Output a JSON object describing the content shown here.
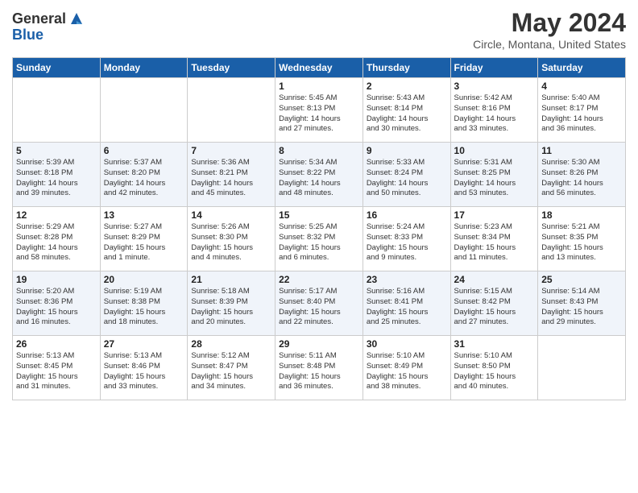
{
  "logo": {
    "general": "General",
    "blue": "Blue"
  },
  "header": {
    "title": "May 2024",
    "subtitle": "Circle, Montana, United States"
  },
  "weekdays": [
    "Sunday",
    "Monday",
    "Tuesday",
    "Wednesday",
    "Thursday",
    "Friday",
    "Saturday"
  ],
  "weeks": [
    [
      {
        "day": "",
        "info": ""
      },
      {
        "day": "",
        "info": ""
      },
      {
        "day": "",
        "info": ""
      },
      {
        "day": "1",
        "info": "Sunrise: 5:45 AM\nSunset: 8:13 PM\nDaylight: 14 hours\nand 27 minutes."
      },
      {
        "day": "2",
        "info": "Sunrise: 5:43 AM\nSunset: 8:14 PM\nDaylight: 14 hours\nand 30 minutes."
      },
      {
        "day": "3",
        "info": "Sunrise: 5:42 AM\nSunset: 8:16 PM\nDaylight: 14 hours\nand 33 minutes."
      },
      {
        "day": "4",
        "info": "Sunrise: 5:40 AM\nSunset: 8:17 PM\nDaylight: 14 hours\nand 36 minutes."
      }
    ],
    [
      {
        "day": "5",
        "info": "Sunrise: 5:39 AM\nSunset: 8:18 PM\nDaylight: 14 hours\nand 39 minutes."
      },
      {
        "day": "6",
        "info": "Sunrise: 5:37 AM\nSunset: 8:20 PM\nDaylight: 14 hours\nand 42 minutes."
      },
      {
        "day": "7",
        "info": "Sunrise: 5:36 AM\nSunset: 8:21 PM\nDaylight: 14 hours\nand 45 minutes."
      },
      {
        "day": "8",
        "info": "Sunrise: 5:34 AM\nSunset: 8:22 PM\nDaylight: 14 hours\nand 48 minutes."
      },
      {
        "day": "9",
        "info": "Sunrise: 5:33 AM\nSunset: 8:24 PM\nDaylight: 14 hours\nand 50 minutes."
      },
      {
        "day": "10",
        "info": "Sunrise: 5:31 AM\nSunset: 8:25 PM\nDaylight: 14 hours\nand 53 minutes."
      },
      {
        "day": "11",
        "info": "Sunrise: 5:30 AM\nSunset: 8:26 PM\nDaylight: 14 hours\nand 56 minutes."
      }
    ],
    [
      {
        "day": "12",
        "info": "Sunrise: 5:29 AM\nSunset: 8:28 PM\nDaylight: 14 hours\nand 58 minutes."
      },
      {
        "day": "13",
        "info": "Sunrise: 5:27 AM\nSunset: 8:29 PM\nDaylight: 15 hours\nand 1 minute."
      },
      {
        "day": "14",
        "info": "Sunrise: 5:26 AM\nSunset: 8:30 PM\nDaylight: 15 hours\nand 4 minutes."
      },
      {
        "day": "15",
        "info": "Sunrise: 5:25 AM\nSunset: 8:32 PM\nDaylight: 15 hours\nand 6 minutes."
      },
      {
        "day": "16",
        "info": "Sunrise: 5:24 AM\nSunset: 8:33 PM\nDaylight: 15 hours\nand 9 minutes."
      },
      {
        "day": "17",
        "info": "Sunrise: 5:23 AM\nSunset: 8:34 PM\nDaylight: 15 hours\nand 11 minutes."
      },
      {
        "day": "18",
        "info": "Sunrise: 5:21 AM\nSunset: 8:35 PM\nDaylight: 15 hours\nand 13 minutes."
      }
    ],
    [
      {
        "day": "19",
        "info": "Sunrise: 5:20 AM\nSunset: 8:36 PM\nDaylight: 15 hours\nand 16 minutes."
      },
      {
        "day": "20",
        "info": "Sunrise: 5:19 AM\nSunset: 8:38 PM\nDaylight: 15 hours\nand 18 minutes."
      },
      {
        "day": "21",
        "info": "Sunrise: 5:18 AM\nSunset: 8:39 PM\nDaylight: 15 hours\nand 20 minutes."
      },
      {
        "day": "22",
        "info": "Sunrise: 5:17 AM\nSunset: 8:40 PM\nDaylight: 15 hours\nand 22 minutes."
      },
      {
        "day": "23",
        "info": "Sunrise: 5:16 AM\nSunset: 8:41 PM\nDaylight: 15 hours\nand 25 minutes."
      },
      {
        "day": "24",
        "info": "Sunrise: 5:15 AM\nSunset: 8:42 PM\nDaylight: 15 hours\nand 27 minutes."
      },
      {
        "day": "25",
        "info": "Sunrise: 5:14 AM\nSunset: 8:43 PM\nDaylight: 15 hours\nand 29 minutes."
      }
    ],
    [
      {
        "day": "26",
        "info": "Sunrise: 5:13 AM\nSunset: 8:45 PM\nDaylight: 15 hours\nand 31 minutes."
      },
      {
        "day": "27",
        "info": "Sunrise: 5:13 AM\nSunset: 8:46 PM\nDaylight: 15 hours\nand 33 minutes."
      },
      {
        "day": "28",
        "info": "Sunrise: 5:12 AM\nSunset: 8:47 PM\nDaylight: 15 hours\nand 34 minutes."
      },
      {
        "day": "29",
        "info": "Sunrise: 5:11 AM\nSunset: 8:48 PM\nDaylight: 15 hours\nand 36 minutes."
      },
      {
        "day": "30",
        "info": "Sunrise: 5:10 AM\nSunset: 8:49 PM\nDaylight: 15 hours\nand 38 minutes."
      },
      {
        "day": "31",
        "info": "Sunrise: 5:10 AM\nSunset: 8:50 PM\nDaylight: 15 hours\nand 40 minutes."
      },
      {
        "day": "",
        "info": ""
      }
    ]
  ]
}
